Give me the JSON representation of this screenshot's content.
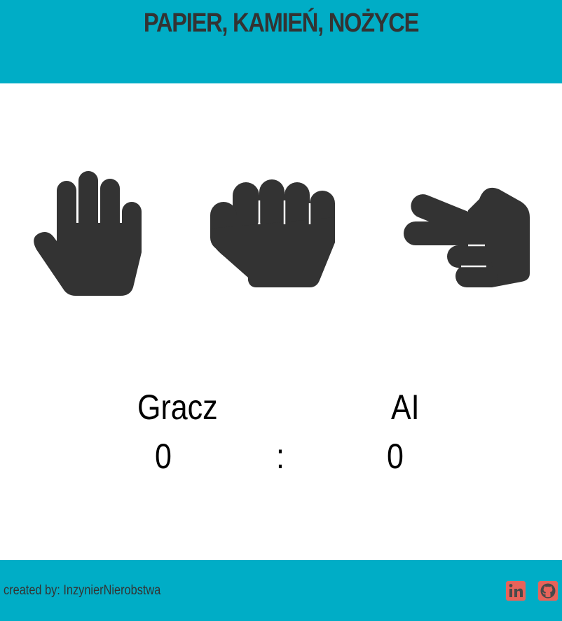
{
  "header": {
    "title": "PAPIER, KAMIEŃ, NOŻYCE"
  },
  "choices": [
    {
      "id": "paper",
      "icon": "hand-paper-icon"
    },
    {
      "id": "rock",
      "icon": "hand-rock-icon"
    },
    {
      "id": "scissors",
      "icon": "hand-scissors-icon"
    }
  ],
  "scoreboard": {
    "player_label": "Gracz",
    "ai_label": "AI",
    "player_score": "0",
    "separator": ":",
    "ai_score": "0"
  },
  "footer": {
    "credits": "created by: InzynierNierobstwa",
    "links": [
      {
        "icon": "linkedin-icon"
      },
      {
        "icon": "github-icon"
      }
    ]
  },
  "colors": {
    "accent": "#00adc6",
    "icon_dark": "#333333",
    "social": "#e8635a",
    "background": "#ffffff"
  }
}
